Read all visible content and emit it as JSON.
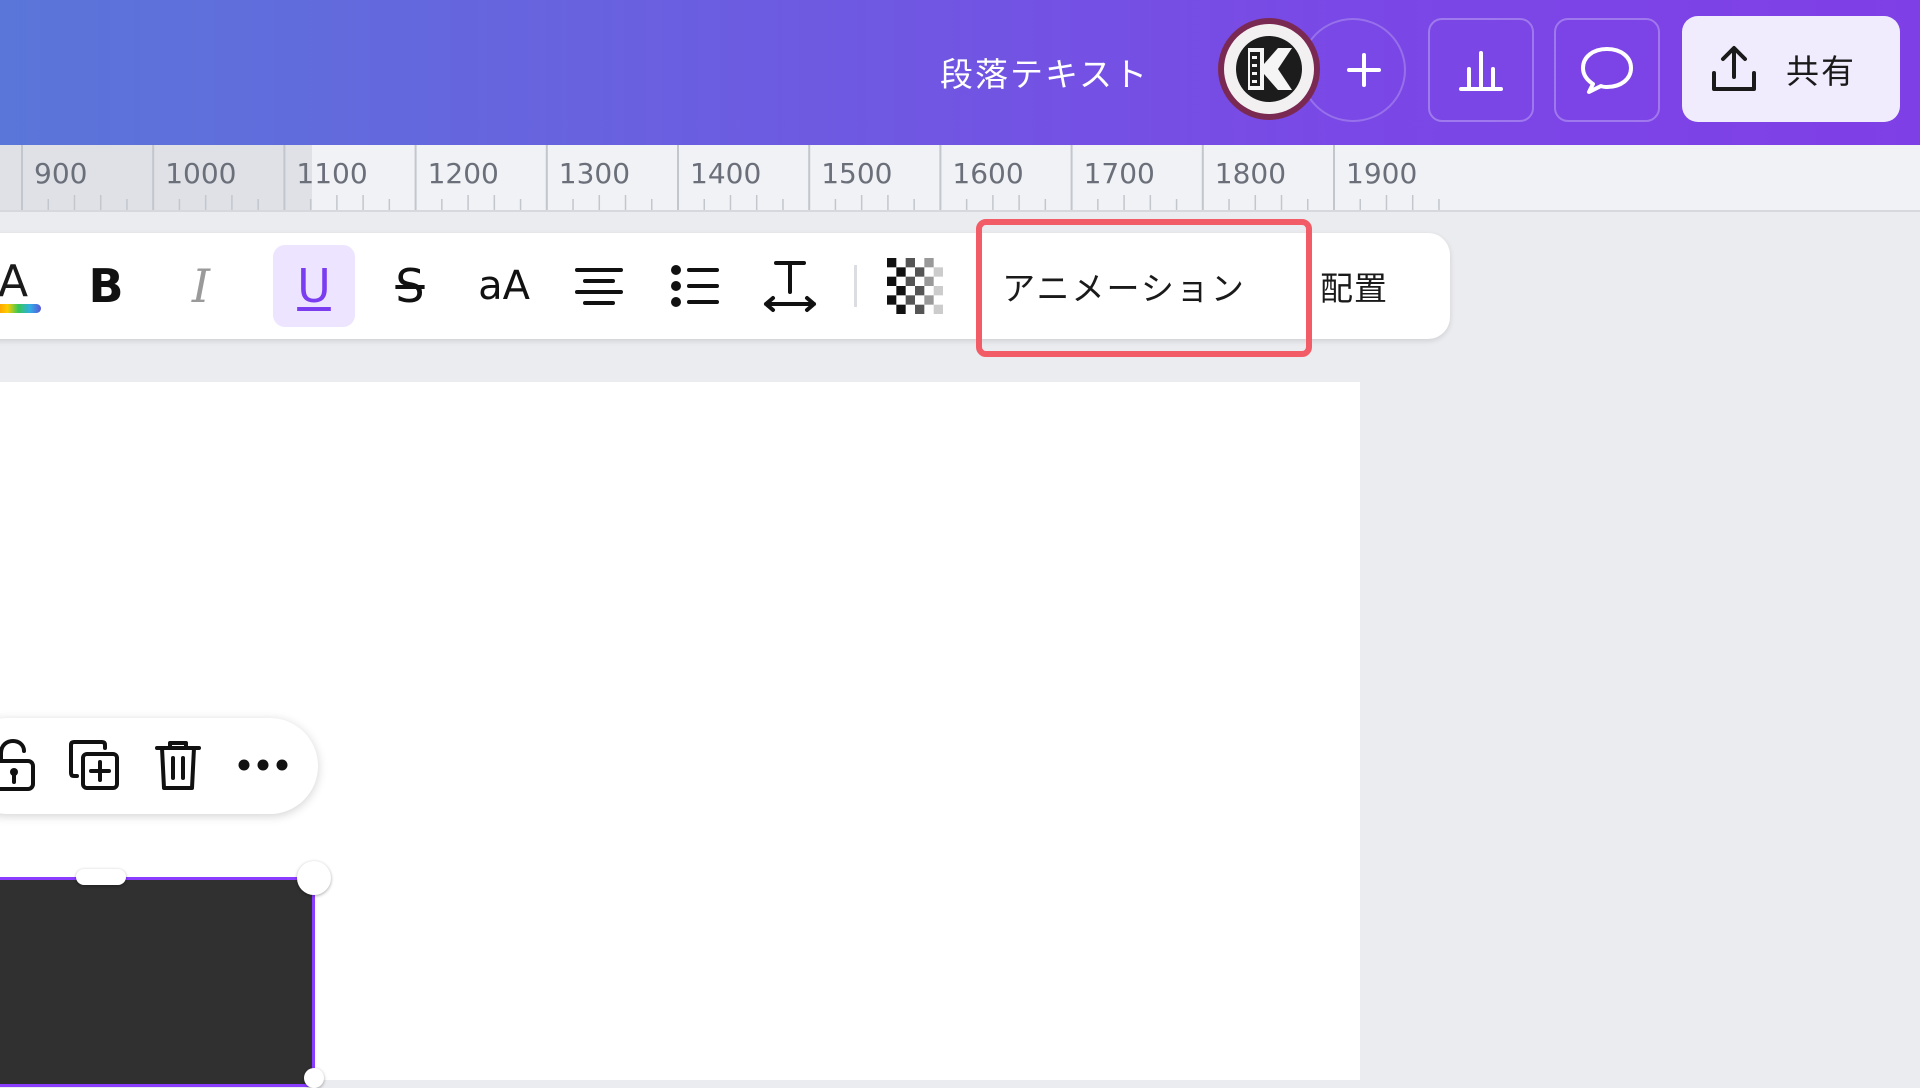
{
  "header": {
    "doc_title": "段落テキスト",
    "share_label": "共有",
    "avatar_icon": "k-logo-icon",
    "add_icon": "plus-icon",
    "insights_icon": "bar-chart-icon",
    "comment_icon": "speech-bubble-icon",
    "share_icon": "upload-icon"
  },
  "ruler": {
    "labels": [
      "900",
      "1000",
      "1100",
      "1200",
      "1300",
      "1400",
      "1500",
      "1600",
      "1700",
      "1800",
      "1900"
    ]
  },
  "toolbar": {
    "items": [
      {
        "name": "text-color",
        "icon": "text-color-icon"
      },
      {
        "name": "bold",
        "icon": "bold-icon"
      },
      {
        "name": "italic",
        "icon": "italic-icon"
      },
      {
        "name": "underline",
        "icon": "underline-icon",
        "active": true
      },
      {
        "name": "strikethrough",
        "icon": "strikethrough-icon"
      },
      {
        "name": "letter-case",
        "icon": "letter-case-icon",
        "text": "aA"
      },
      {
        "name": "align",
        "icon": "align-center-icon"
      },
      {
        "name": "list",
        "icon": "bullet-list-icon"
      },
      {
        "name": "spacing",
        "icon": "text-spacing-icon"
      },
      {
        "name": "transparency",
        "icon": "transparency-icon"
      }
    ],
    "bold_glyph": "B",
    "italic_glyph": "I",
    "underline_glyph": "U",
    "strike_glyph": "S",
    "case_glyph": "aA",
    "color_glyph": "A",
    "animation_label": "アニメーション",
    "position_label": "配置"
  },
  "context_menu": {
    "items": [
      "lock-icon",
      "duplicate-icon",
      "trash-icon",
      "more-icon"
    ]
  },
  "colors": {
    "header_start": "#5a76d9",
    "header_end": "#7f3fe6",
    "accent": "#8b3dff",
    "highlight": "#f25c66",
    "selection_fill": "#303030"
  }
}
